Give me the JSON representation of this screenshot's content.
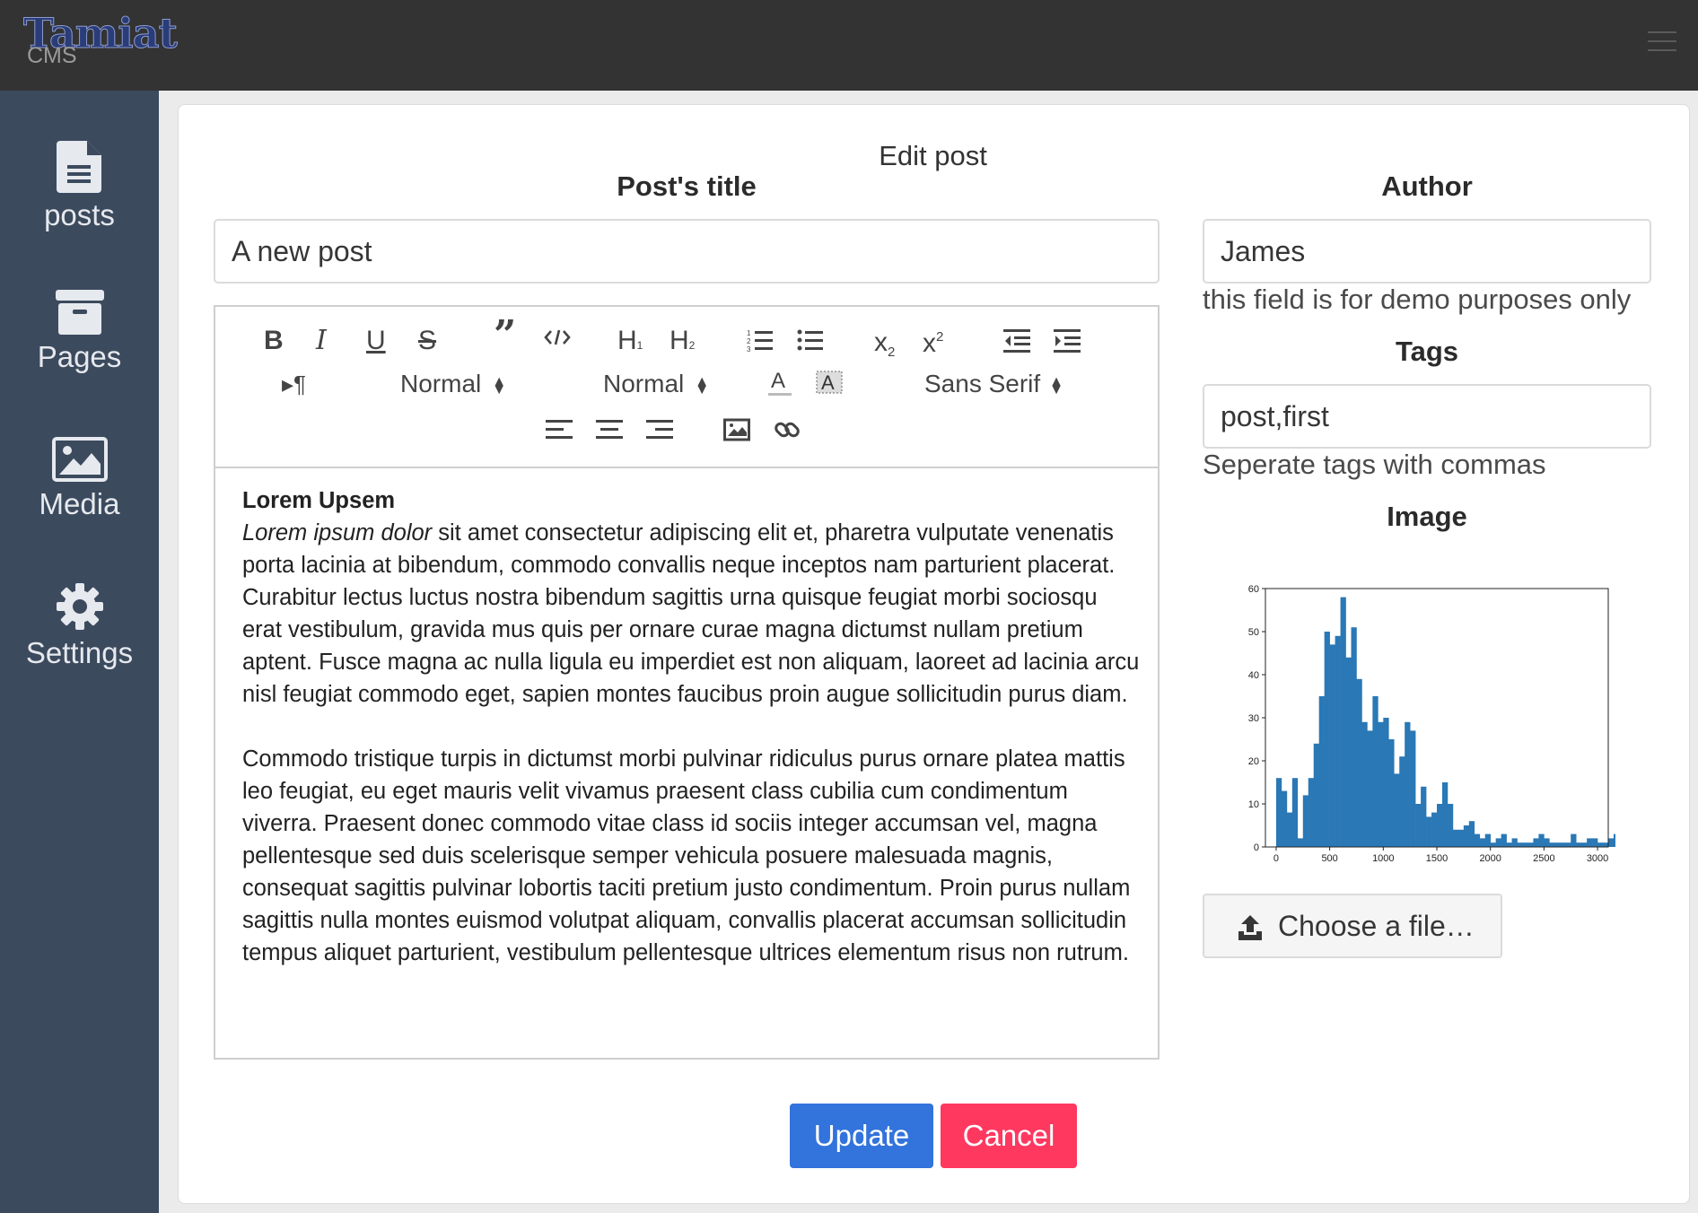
{
  "app": {
    "logo_main": "Tamiat",
    "logo_sub": "CMS"
  },
  "sidebar": {
    "items": [
      {
        "label": "posts",
        "icon": "document-icon"
      },
      {
        "label": "Pages",
        "icon": "archive-icon"
      },
      {
        "label": "Media",
        "icon": "image-icon"
      },
      {
        "label": "Settings",
        "icon": "gear-icon"
      }
    ]
  },
  "page": {
    "title": "Edit post"
  },
  "form": {
    "title_label": "Post's title",
    "title_value": "A new post",
    "author_label": "Author",
    "author_value": "James",
    "author_help": "this field is for demo purposes only",
    "tags_label": "Tags",
    "tags_value": "post,first",
    "tags_help": "Seperate tags with commas",
    "image_label": "Image",
    "file_button": "Choose a file…",
    "update_button": "Update",
    "cancel_button": "Cancel"
  },
  "toolbar": {
    "header_select": "Normal",
    "size_select": "Normal",
    "font_select": "Sans Serif",
    "buttons": [
      "bold",
      "italic",
      "underline",
      "strike",
      "blockquote",
      "code-block",
      "header-1",
      "header-2",
      "ordered-list",
      "bullet-list",
      "subscript",
      "superscript",
      "outdent",
      "indent",
      "text-direction",
      "font-color",
      "background-color",
      "align-left",
      "align-center",
      "align-right",
      "image",
      "link"
    ]
  },
  "editor": {
    "heading": "Lorem Upsem",
    "p1_italic": "Lorem ipsum dolor",
    "p1_rest": " sit amet consectetur adipiscing elit et, pharetra vulputate venenatis porta lacinia at bibendum, commodo convallis neque inceptos nam parturient placerat. Curabitur lectus luctus nostra bibendum sagittis urna quisque feugiat morbi sociosqu erat vestibulum, gravida mus quis per ornare curae magna dictumst nullam pretium aptent. Fusce magna ac nulla ligula eu imperdiet est non aliquam, laoreet ad lacinia arcu nisl feugiat commodo eget, sapien montes faucibus proin augue sollicitudin purus diam.",
    "p2": "Commodo tristique turpis in dictumst morbi pulvinar ridiculus purus ornare platea mattis leo feugiat, eu eget mauris velit vivamus praesent class cubilia cum condimentum viverra. Praesent donec commodo vitae class id sociis integer accumsan vel, magna pellentesque sed duis scelerisque semper vehicula posuere malesuada magnis, consequat sagittis pulvinar lobortis taciti pretium justo condimentum. Proin purus nullam sagittis nulla montes euismod volutpat aliquam, convallis placerat accumsan sollicitudin tempus aliquet parturient, vestibulum pellentesque ultrices elementum risus non rutrum."
  },
  "colors": {
    "topbar": "#333333",
    "sidebar": "#3c4a5e",
    "primary": "#3273dc",
    "danger": "#ff3860",
    "bar": "#2a78b5"
  },
  "chart_data": {
    "type": "bar",
    "x_ticks": [
      0,
      500,
      1000,
      1500,
      2000,
      2500,
      3000
    ],
    "y_ticks": [
      0,
      10,
      20,
      30,
      40,
      50,
      60
    ],
    "xlim": [
      -100,
      3100
    ],
    "ylim": [
      0,
      60
    ],
    "bin_width": 50,
    "x_start": 0,
    "values": [
      16,
      13,
      8,
      16,
      2,
      12,
      16,
      24,
      35,
      50,
      47,
      49,
      58,
      44,
      51,
      39,
      29,
      27,
      35,
      29,
      30,
      25,
      17,
      21,
      29,
      27,
      10,
      14,
      7,
      8,
      10,
      15,
      10,
      4,
      4,
      5,
      6,
      3,
      2,
      3,
      1,
      2,
      3,
      1,
      2,
      1,
      1,
      1,
      2,
      3,
      2,
      1,
      1,
      1,
      1,
      3,
      1,
      1,
      2,
      2,
      1,
      1,
      2,
      3,
      1,
      1,
      1,
      1,
      2,
      1,
      1,
      7,
      1,
      1,
      1,
      1,
      1,
      1,
      1,
      1,
      1,
      1,
      1,
      1,
      1,
      1,
      1,
      1,
      1,
      1,
      1,
      1,
      1,
      1,
      1,
      1
    ]
  }
}
